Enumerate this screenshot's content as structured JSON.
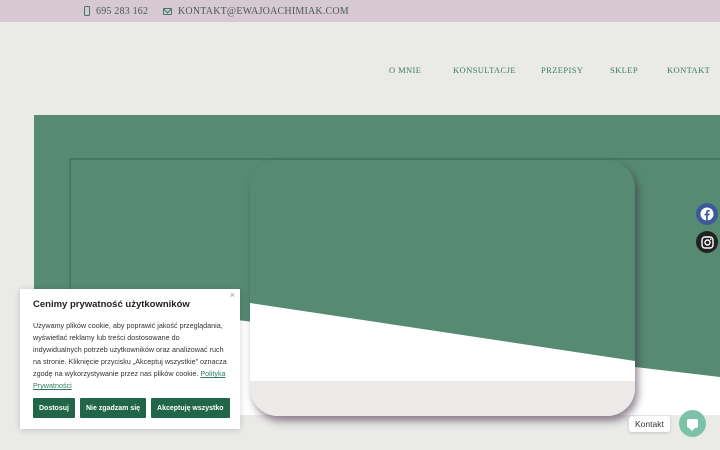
{
  "topbar": {
    "phone": "695 283 162",
    "email": "KONTAKT@EWAJOACHIMIAK.COM"
  },
  "nav": {
    "items": [
      {
        "label": "O MNIE"
      },
      {
        "label": "KONSULTACJE"
      },
      {
        "label": "PRZEPISY"
      },
      {
        "label": "SKLEP"
      },
      {
        "label": "KONTAKT"
      }
    ]
  },
  "social": {
    "icons": [
      "facebook-icon",
      "instagram-icon"
    ]
  },
  "cookie": {
    "title": "Cenimy prywatność użytkowników",
    "body": "Używamy plików cookie, aby poprawić jakość przeglądania, wyświetlać reklamy lub treści dostosowane do indywidualnych potrzeb użytkowników oraz analizować ruch na stronie. Kliknięcie przycisku „Akceptuj wszystkie” oznacza zgodę na wykorzystywanie przez nas plików cookie.",
    "policy_link": "Polityka Prywatności",
    "close": "×",
    "buttons": {
      "customize": "Dostosuj",
      "reject": "Nie zgadzam się",
      "accept": "Akceptuję wszystko"
    }
  },
  "contact_widget": {
    "label": "Kontakt"
  },
  "colors": {
    "topbar": "#d6c9d2",
    "brand_green": "#568a72",
    "button_green": "#22664a",
    "background": "#eaeae8"
  }
}
